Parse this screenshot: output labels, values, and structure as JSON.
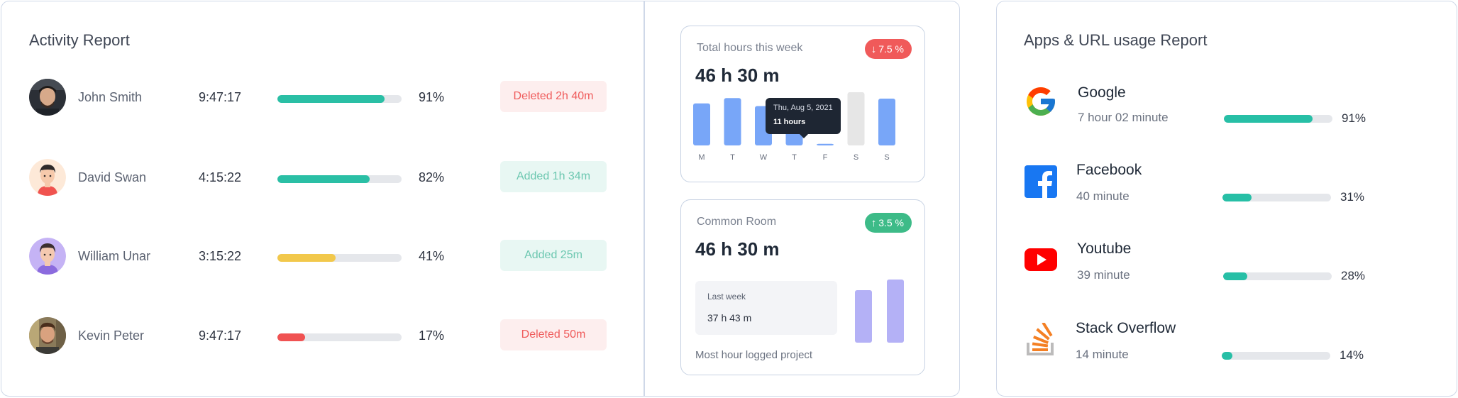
{
  "activity": {
    "title": "Activity Report",
    "rows": [
      {
        "name": "John Smith",
        "time": "9:47:17",
        "percent_label": "91%",
        "percent": 0.86,
        "bar_color": "#2abfa5",
        "badge": "Deleted 2h 40m",
        "badge_type": "deleted",
        "avatar": "photo-avatar"
      },
      {
        "name": "David Swan",
        "time": "4:15:22",
        "percent_label": "82%",
        "percent": 0.74,
        "bar_color": "#2abfa5",
        "badge": "Added 1h 34m",
        "badge_type": "added",
        "avatar": "cartoon-avatar"
      },
      {
        "name": "William Unar",
        "time": "3:15:22",
        "percent_label": "41%",
        "percent": 0.47,
        "bar_color": "#f2c84b",
        "badge": "Added 25m",
        "badge_type": "added",
        "avatar": "cartoon-avatar"
      },
      {
        "name": "Kevin Peter",
        "time": "9:47:17",
        "percent_label": "17%",
        "percent": 0.22,
        "bar_color": "#f05252",
        "badge": "Deleted 50m",
        "badge_type": "deleted",
        "avatar": "photo-avatar"
      }
    ]
  },
  "hours_card": {
    "label": "Total hours this week",
    "value": "46 h 30 m",
    "change": "7.5 %",
    "change_dir": "down",
    "tooltip_date": "Thu, Aug 5, 2021",
    "tooltip_value": "11 hours"
  },
  "room_card": {
    "label": "Common Room",
    "value": "46 h 30 m",
    "change": "3.5 %",
    "change_dir": "up",
    "last_week_label": "Last week",
    "last_week_value": "37 h 43 m",
    "footer": "Most hour logged project"
  },
  "chart_data": [
    {
      "type": "bar",
      "categories": [
        "M",
        "T",
        "W",
        "T",
        "F",
        "S",
        "S"
      ],
      "values": [
        0.79,
        0.89,
        0.74,
        0.57,
        0.03,
        1.0,
        0.88
      ],
      "highlight_index": 3,
      "colors": {
        "normal": "#78a6f8",
        "muted": "#e6e6e6",
        "accent": "#78a6f8"
      },
      "muted_index": 5
    },
    {
      "type": "bar",
      "categories": [
        "",
        ""
      ],
      "values": [
        0.83,
        1.0
      ],
      "colors": {
        "normal": "#b4b1f6"
      }
    }
  ],
  "apps": {
    "title": "Apps & URL usage Report",
    "items": [
      {
        "name": "Google",
        "duration": "7 hour 02 minute",
        "percent_label": "91%",
        "percent": 0.82,
        "icon": "google-icon"
      },
      {
        "name": "Facebook",
        "duration": "40 minute",
        "percent_label": "31%",
        "percent": 0.27,
        "icon": "facebook-icon"
      },
      {
        "name": "Youtube",
        "duration": "39 minute",
        "percent_label": "28%",
        "percent": 0.22,
        "icon": "youtube-icon"
      },
      {
        "name": "Stack Overflow",
        "duration": "14 minute",
        "percent_label": "14%",
        "percent": 0.1,
        "icon": "stack-overflow-icon"
      }
    ]
  }
}
